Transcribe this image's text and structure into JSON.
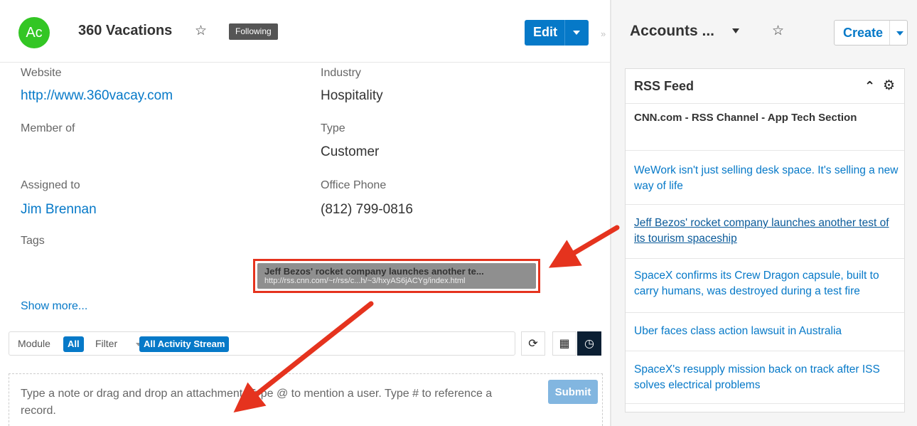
{
  "record": {
    "avatar": "Ac",
    "name": "360 Vacations",
    "following": "Following",
    "edit": "Edit"
  },
  "fields": {
    "website_label": "Website",
    "website_value": "http://www.360vacay.com",
    "industry_label": "Industry",
    "industry_value": "Hospitality",
    "member_label": "Member of",
    "type_label": "Type",
    "type_value": "Customer",
    "assigned_label": "Assigned to",
    "assigned_value": "Jim Brennan",
    "phone_label": "Office Phone",
    "phone_value": "(812) 799-0816",
    "tags_label": "Tags",
    "show_more": "Show more..."
  },
  "tooltip": {
    "title": "Jeff Bezos' rocket company launches another te...",
    "url": "http://rss.cnn.com/~r/rss/c...h/~3/hxyAS6jACYg/index.html"
  },
  "activity": {
    "module_label": "Module",
    "module_value": "All",
    "filter_label": "Filter",
    "filter_value": "All Activity Stream",
    "composer_placeholder": "Type a note or drag and drop an attachment. Type @ to mention a user. Type # to reference a record.",
    "submit": "Submit"
  },
  "right_panel": {
    "title": "Accounts ...",
    "create": "Create"
  },
  "rss": {
    "title": "RSS Feed",
    "channel": "CNN.com - RSS Channel - App Tech Section",
    "items": [
      "WeWork isn't just selling desk space. It's selling a new way of life",
      "Jeff Bezos' rocket company launches another test of its tourism spaceship",
      "SpaceX confirms its Crew Dragon capsule, built to carry humans, was destroyed during a test fire",
      "Uber faces class action lawsuit in Australia",
      "SpaceX's resupply mission back on track after ISS solves electrical problems"
    ]
  },
  "colors": {
    "accent": "#0679c8",
    "avatar": "#33c624",
    "annotation": "#e5331e"
  },
  "icons": {
    "favorite": "star-icon",
    "refresh": "refresh-icon",
    "list_view": "table-icon",
    "timeline_view": "clock-icon",
    "collapse": "chevron-up-icon",
    "settings": "gear-icon"
  }
}
